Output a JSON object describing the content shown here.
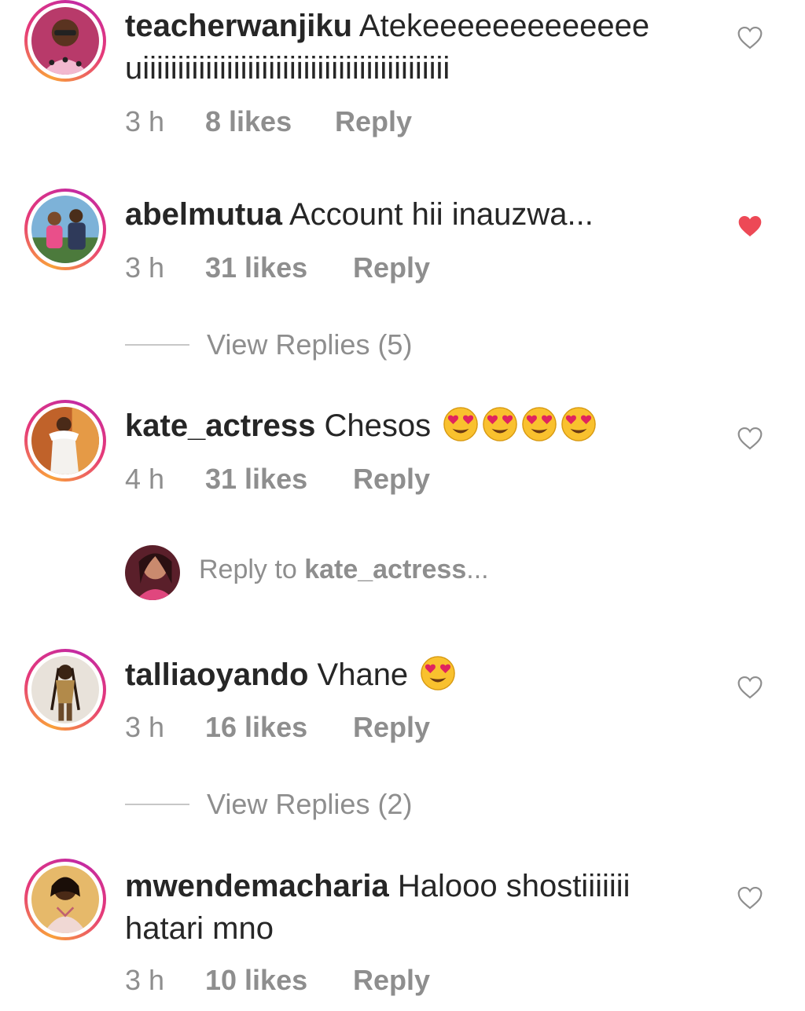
{
  "colors": {
    "liked_heart": "#ed4956",
    "muted_text": "#8e8e8e",
    "ring_start": "#f9a13a",
    "ring_end": "#c32aa3"
  },
  "comments": [
    {
      "username": "teacherwanjiku",
      "text": "Atekeeeeeeeeeeeee uiiiiiiiiiiiiiiiiiiiiiiiiiiiiiiiiiiiiiiiiiiii",
      "time": "3 h",
      "likes": "8 likes",
      "reply": "Reply",
      "liked": false,
      "icon": "heart-outline-icon"
    },
    {
      "username": "abelmutua",
      "text": "Account hii inauzwa...",
      "time": "3 h",
      "likes": "31 likes",
      "reply": "Reply",
      "liked": true,
      "icon": "heart-filled-icon",
      "view_replies": "View Replies (5)"
    },
    {
      "username": "kate_actress",
      "text": "Chesos",
      "emoji": "heart-eyes-emoji",
      "emoji_count": 4,
      "time": "4 h",
      "likes": "31 likes",
      "reply": "Reply",
      "liked": false,
      "icon": "heart-outline-icon"
    },
    {
      "username": "talliaoyando",
      "text": "Vhane",
      "emoji": "heart-eyes-emoji",
      "emoji_count": 1,
      "time": "3 h",
      "likes": "16 likes",
      "reply": "Reply",
      "liked": false,
      "icon": "heart-outline-icon",
      "view_replies": "View Replies (2)"
    },
    {
      "username": "mwendemacharia",
      "text": "Halooo shostiiiiiii hatari mno",
      "time": "3 h",
      "likes": "10 likes",
      "reply": "Reply",
      "liked": false,
      "icon": "heart-outline-icon"
    }
  ],
  "reply_input": {
    "prefix": "Reply to ",
    "target": "kate_actress",
    "suffix": "..."
  }
}
